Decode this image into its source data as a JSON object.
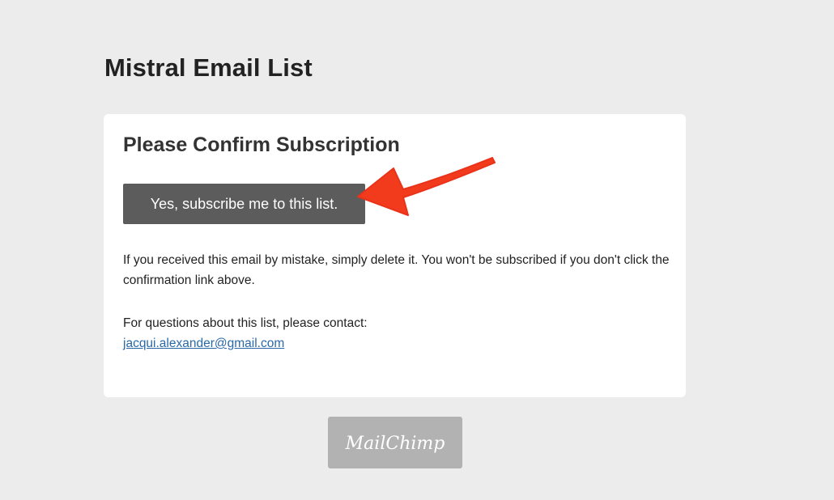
{
  "page": {
    "title": "Mistral Email List"
  },
  "card": {
    "heading": "Please Confirm Subscription",
    "confirm_button_label": "Yes, subscribe me to this list.",
    "mistake_text": "If you received this email by mistake, simply delete it. You won't be subscribed if you don't click the confirmation link above.",
    "contact_prompt": "For questions about this list, please contact:",
    "contact_email": "jacqui.alexander@gmail.com"
  },
  "footer": {
    "logo_text": "MailChimp",
    "logo_icon": "mailchimp-logo"
  },
  "annotation": {
    "icon": "red-arrow-icon",
    "color": "#f23b1d"
  },
  "colors": {
    "background": "#ececec",
    "card": "#ffffff",
    "button": "#5c5c5c",
    "link": "#2a69a8",
    "badge": "#b2b2b2"
  }
}
